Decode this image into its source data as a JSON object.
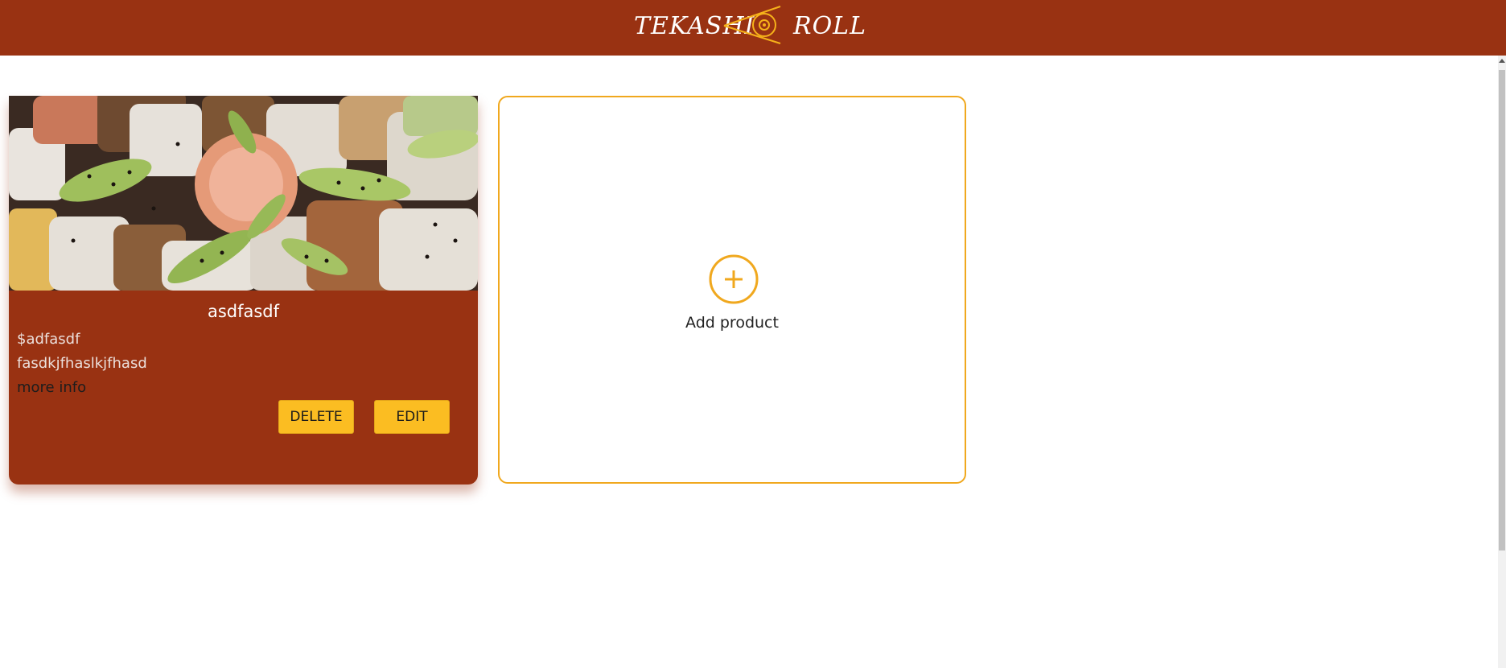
{
  "header": {
    "logo_word_left": "TEKASHI",
    "logo_word_right": "ROLL",
    "logo_icon": "chopsticks-roll-icon",
    "background_color": "#993212",
    "logo_accent_color": "#f6b21a"
  },
  "products": [
    {
      "image_alt": "sushi rolls with avocado and sesame",
      "name": "asdfasdf",
      "price": "$adfasdf",
      "description": "fasdkjfhaslkjfhasd",
      "more_info_label": "more info",
      "delete_label": "DELETE",
      "edit_label": "EDIT"
    }
  ],
  "add_card": {
    "label": "Add product",
    "icon": "plus-circle-icon",
    "border_color": "#f0a81e"
  },
  "theme": {
    "card_color": "#993212",
    "button_color": "#fbbd22"
  }
}
